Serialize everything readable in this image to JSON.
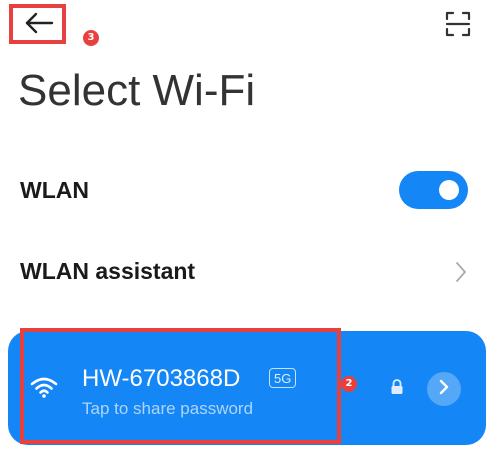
{
  "page": {
    "title": "Select Wi-Fi"
  },
  "header": {
    "back_icon": "arrow-left-icon",
    "scan_icon": "scan-qr-icon"
  },
  "settings": {
    "wlan": {
      "label": "WLAN",
      "enabled": true
    },
    "assistant": {
      "label": "WLAN assistant"
    }
  },
  "network": {
    "ssid": "HW-6703868D",
    "band": "5G",
    "subtitle": "Tap to share password",
    "secured": true
  },
  "annotations": {
    "back_marker": "3",
    "network_marker": "2"
  },
  "colors": {
    "accent": "#1486f5",
    "annotation": "#e8403f"
  }
}
